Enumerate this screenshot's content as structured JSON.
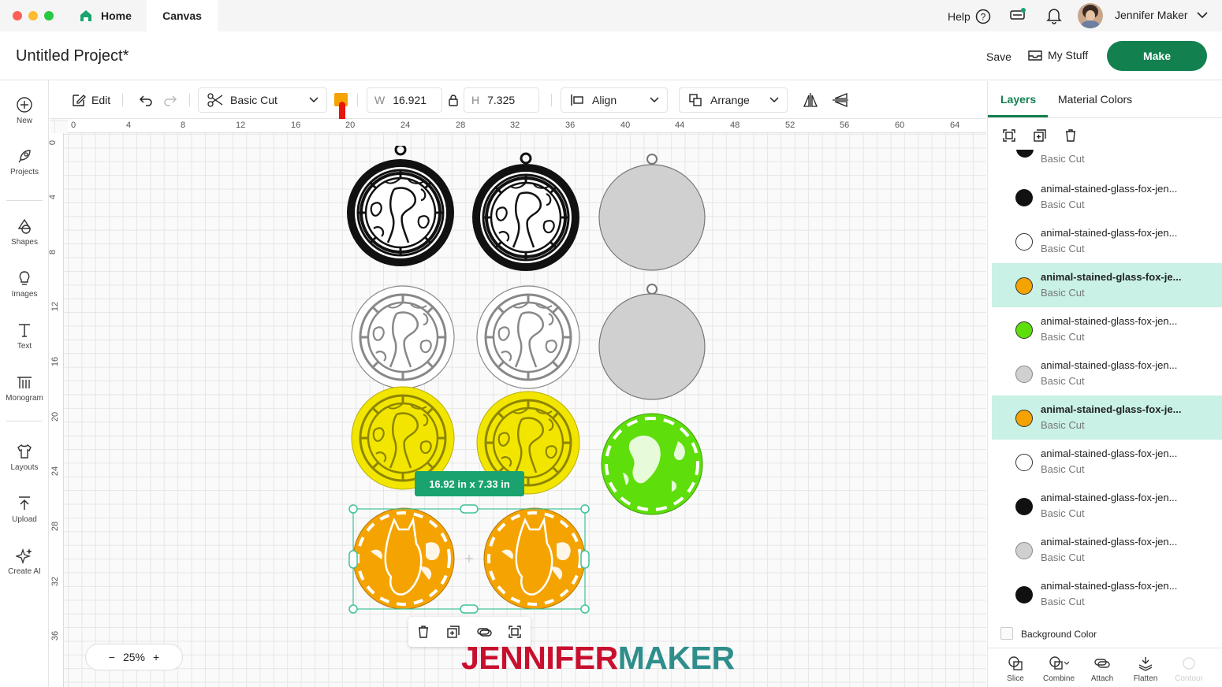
{
  "window": {
    "tabs": [
      "Home",
      "Canvas"
    ],
    "help_label": "Help",
    "user_name": "Jennifer Maker"
  },
  "header": {
    "project_title": "Untitled Project*",
    "save_label": "Save",
    "my_stuff_label": "My Stuff",
    "make_label": "Make"
  },
  "sidebar": {
    "items": [
      {
        "label": "New",
        "icon": "plus-circle-icon"
      },
      {
        "label": "Projects",
        "icon": "rocket-icon"
      },
      {
        "label": "Shapes",
        "icon": "shapes-icon"
      },
      {
        "label": "Images",
        "icon": "lightbulb-icon"
      },
      {
        "label": "Text",
        "icon": "text-icon"
      },
      {
        "label": "Monogram",
        "icon": "monogram-icon"
      },
      {
        "label": "Layouts",
        "icon": "shirt-icon"
      },
      {
        "label": "Upload",
        "icon": "upload-icon"
      },
      {
        "label": "Create AI",
        "icon": "sparkle-icon"
      }
    ]
  },
  "toolbar": {
    "edit_label": "Edit",
    "operation": "Basic Cut",
    "swatch_color": "#f5a300",
    "width_label": "W",
    "width_value": "16.921",
    "height_label": "H",
    "height_value": "7.325",
    "align_label": "Align",
    "arrange_label": "Arrange"
  },
  "canvas": {
    "ruler_top": [
      "0",
      "4",
      "8",
      "12",
      "16",
      "20",
      "24",
      "28",
      "32",
      "36",
      "40",
      "44",
      "48",
      "52",
      "56",
      "60",
      "64"
    ],
    "ruler_left": [
      "0",
      "4",
      "8",
      "12",
      "16",
      "20",
      "24",
      "28",
      "32",
      "36"
    ],
    "size_badge": "16.92  in x 7.33  in",
    "zoom": "25%",
    "zoom_minus": "−",
    "zoom_plus": "+",
    "watermark_part1": "JENNIFER",
    "watermark_part2": "MAKER",
    "colors": {
      "black": "#111111",
      "white": "#ffffff",
      "yellow": "#f2e600",
      "green": "#5ede0a",
      "orange": "#f5a300",
      "gray": "#d0d0d0",
      "accent": "#1aa36f"
    }
  },
  "panel": {
    "tabs": [
      "Layers",
      "Material Colors"
    ],
    "partial_item_sub": "Basic Cut",
    "layers": [
      {
        "name": "animal-stained-glass-fox-jen...",
        "sub": "Basic Cut",
        "thumb": "#111111",
        "selected": false
      },
      {
        "name": "animal-stained-glass-fox-jen...",
        "sub": "Basic Cut",
        "thumb": "#ffffff",
        "selected": false
      },
      {
        "name": "animal-stained-glass-fox-je...",
        "sub": "Basic Cut",
        "thumb": "#f5a300",
        "selected": true
      },
      {
        "name": "animal-stained-glass-fox-jen...",
        "sub": "Basic Cut",
        "thumb": "#5ede0a",
        "selected": false
      },
      {
        "name": "animal-stained-glass-fox-jen...",
        "sub": "Basic Cut",
        "thumb": "#d0d0d0",
        "selected": false
      },
      {
        "name": "animal-stained-glass-fox-je...",
        "sub": "Basic Cut",
        "thumb": "#f5a300",
        "selected": true
      },
      {
        "name": "animal-stained-glass-fox-jen...",
        "sub": "Basic Cut",
        "thumb": "#ffffff",
        "selected": false
      },
      {
        "name": "animal-stained-glass-fox-jen...",
        "sub": "Basic Cut",
        "thumb": "#111111",
        "selected": false
      },
      {
        "name": "animal-stained-glass-fox-jen...",
        "sub": "Basic Cut",
        "thumb": "#d0d0d0",
        "selected": false
      },
      {
        "name": "animal-stained-glass-fox-jen...",
        "sub": "Basic Cut",
        "thumb": "#111111",
        "selected": false
      }
    ],
    "background_color_label": "Background Color",
    "actions": [
      "Slice",
      "Combine",
      "Attach",
      "Flatten",
      "Contour"
    ]
  }
}
